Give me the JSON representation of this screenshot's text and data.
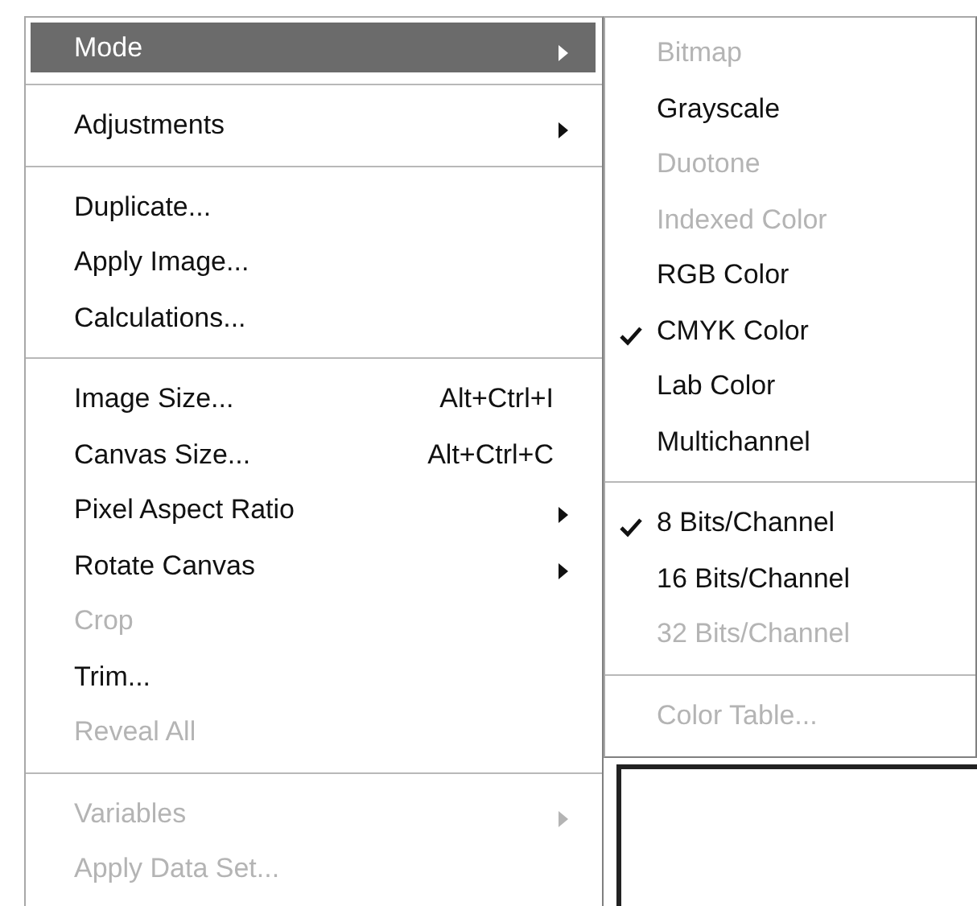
{
  "image_menu": {
    "items": [
      {
        "kind": "item",
        "label": "Mode",
        "submenu": true,
        "selected": true,
        "disabled": false
      },
      {
        "kind": "separator"
      },
      {
        "kind": "item",
        "label": "Adjustments",
        "submenu": true,
        "selected": false,
        "disabled": false
      },
      {
        "kind": "separator"
      },
      {
        "kind": "item",
        "label": "Duplicate...",
        "submenu": false,
        "selected": false,
        "disabled": false
      },
      {
        "kind": "item",
        "label": "Apply Image...",
        "submenu": false,
        "selected": false,
        "disabled": false
      },
      {
        "kind": "item",
        "label": "Calculations...",
        "submenu": false,
        "selected": false,
        "disabled": false
      },
      {
        "kind": "separator"
      },
      {
        "kind": "item",
        "label": "Image Size...",
        "shortcut": "Alt+Ctrl+I",
        "submenu": false,
        "selected": false,
        "disabled": false
      },
      {
        "kind": "item",
        "label": "Canvas Size...",
        "shortcut": "Alt+Ctrl+C",
        "submenu": false,
        "selected": false,
        "disabled": false
      },
      {
        "kind": "item",
        "label": "Pixel Aspect Ratio",
        "submenu": true,
        "selected": false,
        "disabled": false
      },
      {
        "kind": "item",
        "label": "Rotate Canvas",
        "submenu": true,
        "selected": false,
        "disabled": false
      },
      {
        "kind": "item",
        "label": "Crop",
        "submenu": false,
        "selected": false,
        "disabled": true
      },
      {
        "kind": "item",
        "label": "Trim...",
        "submenu": false,
        "selected": false,
        "disabled": false
      },
      {
        "kind": "item",
        "label": "Reveal All",
        "submenu": false,
        "selected": false,
        "disabled": true
      },
      {
        "kind": "separator"
      },
      {
        "kind": "item",
        "label": "Variables",
        "submenu": true,
        "selected": false,
        "disabled": true
      },
      {
        "kind": "item",
        "label": "Apply Data Set...",
        "submenu": false,
        "selected": false,
        "disabled": true
      }
    ]
  },
  "mode_submenu": {
    "items": [
      {
        "kind": "item",
        "label": "Bitmap",
        "checked": false,
        "disabled": true
      },
      {
        "kind": "item",
        "label": "Grayscale",
        "checked": false,
        "disabled": false
      },
      {
        "kind": "item",
        "label": "Duotone",
        "checked": false,
        "disabled": true
      },
      {
        "kind": "item",
        "label": "Indexed Color",
        "checked": false,
        "disabled": true
      },
      {
        "kind": "item",
        "label": "RGB Color",
        "checked": false,
        "disabled": false
      },
      {
        "kind": "item",
        "label": "CMYK Color",
        "checked": true,
        "disabled": false
      },
      {
        "kind": "item",
        "label": "Lab Color",
        "checked": false,
        "disabled": false
      },
      {
        "kind": "item",
        "label": "Multichannel",
        "checked": false,
        "disabled": false
      },
      {
        "kind": "separator"
      },
      {
        "kind": "item",
        "label": "8 Bits/Channel",
        "checked": true,
        "disabled": false
      },
      {
        "kind": "item",
        "label": "16 Bits/Channel",
        "checked": false,
        "disabled": false
      },
      {
        "kind": "item",
        "label": "32 Bits/Channel",
        "checked": false,
        "disabled": true
      },
      {
        "kind": "separator"
      },
      {
        "kind": "item",
        "label": "Color Table...",
        "checked": false,
        "disabled": true
      }
    ]
  }
}
